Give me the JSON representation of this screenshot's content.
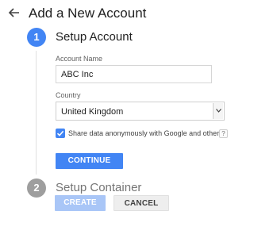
{
  "header": {
    "title": "Add a New Account",
    "back_icon": "back-arrow-icon"
  },
  "steps": [
    {
      "number": "1",
      "label": "Setup Account",
      "state": "active"
    },
    {
      "number": "2",
      "label": "Setup Container",
      "state": "inactive"
    }
  ],
  "account": {
    "label": "Account Name",
    "value": "ABC Inc"
  },
  "country": {
    "label": "Country",
    "selected": "United Kingdom"
  },
  "share": {
    "checked": true,
    "label": "Share data anonymously with Google and others",
    "help": "?"
  },
  "buttons": {
    "continue": "CONTINUE",
    "create": "CREATE",
    "cancel": "CANCEL"
  },
  "colors": {
    "accent": "#4285f4",
    "inactive": "#9e9e9e",
    "disabled_accent": "#a9c6f7"
  }
}
